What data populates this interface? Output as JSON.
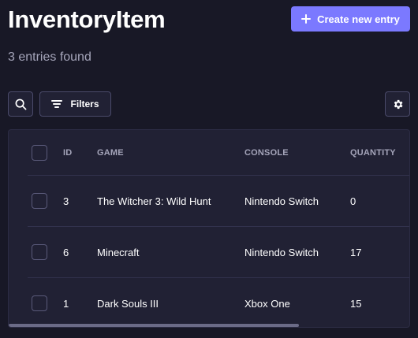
{
  "header": {
    "title": "InventoryItem",
    "subtitle": "3 entries found",
    "create_label": "Create new entry"
  },
  "toolbar": {
    "filters_label": "Filters"
  },
  "table": {
    "columns": {
      "id": "ID",
      "game": "GAME",
      "console": "CONSOLE",
      "quantity": "QUANTITY"
    },
    "rows": [
      {
        "id": "3",
        "game": "The Witcher 3: Wild Hunt",
        "console": "Nintendo Switch",
        "quantity": "0"
      },
      {
        "id": "6",
        "game": "Minecraft",
        "console": "Nintendo Switch",
        "quantity": "17"
      },
      {
        "id": "1",
        "game": "Dark Souls III",
        "console": "Xbox One",
        "quantity": "15"
      }
    ]
  },
  "icons": {
    "search": "search-icon",
    "filter": "filter-icon",
    "settings": "gear-icon",
    "plus": "plus-icon"
  },
  "colors": {
    "background": "#181826",
    "surface": "#212134",
    "primary": "#7b79ff",
    "muted_text": "#a5a5ba",
    "border": "#4a4a6a"
  }
}
